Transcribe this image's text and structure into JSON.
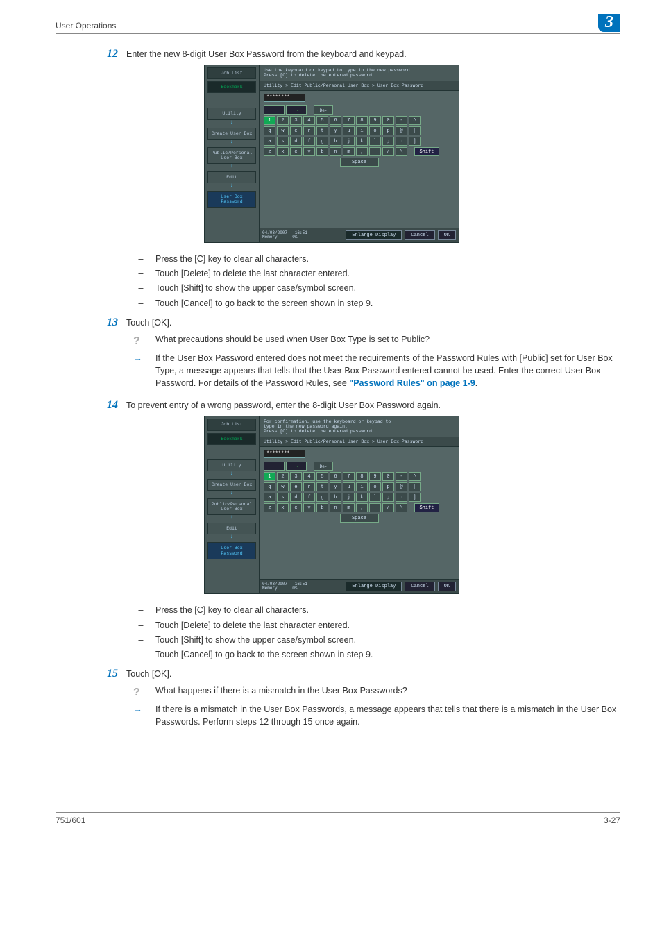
{
  "header": {
    "left": "User Operations",
    "right": "3"
  },
  "steps": {
    "s12": {
      "num": "12",
      "text": "Enter the new 8-digit User Box Password from the keyboard and keypad.",
      "bullets": [
        "Press the [C] key to clear all characters.",
        "Touch [Delete] to delete the last character entered.",
        "Touch [Shift] to show the upper case/symbol screen.",
        "Touch [Cancel] to go back to the screen shown in step 9."
      ]
    },
    "s13": {
      "num": "13",
      "text": "Touch [OK].",
      "q": "What precautions should be used when User Box Type is set to Public?",
      "a_pre": "If the User Box Password entered does not meet the requirements of the Password Rules with [Public] set for User Box Type, a message appears that tells that the User Box Password entered cannot be used. Enter the correct User Box Password. For details of the Password Rules, see ",
      "a_link": "\"Password Rules\" on page 1-9",
      "a_post": "."
    },
    "s14": {
      "num": "14",
      "text": "To prevent entry of a wrong password, enter the 8-digit User Box Password again.",
      "bullets": [
        "Press the [C] key to clear all characters.",
        "Touch [Delete] to delete the last character entered.",
        "Touch [Shift] to show the upper case/symbol screen.",
        "Touch [Cancel] to go back to the screen shown in step 9."
      ]
    },
    "s15": {
      "num": "15",
      "text": "Touch [OK].",
      "q": "What happens if there is a mismatch in the User Box Passwords?",
      "a": "If there is a mismatch in the User Box Passwords, a message appears that tells that there is a mismatch in the User Box Passwords. Perform steps 12 through 15 once again."
    }
  },
  "ui": {
    "msg1": "Use the keyboard or keypad to type in the new password.\nPress [C] to delete the entered password.",
    "msg2": "For confirmation, use the keyboard or keypad to\ntype in the new password again.\nPress [C] to delete the entered password.",
    "path": "Utility > Edit Public/Personal User Box > User Box Password",
    "input": "********",
    "left": {
      "job": "Job List",
      "bookmark": "Bookmark",
      "utility": "Utility",
      "create": "Create User Box",
      "pp": "Public/Personal\nUser Box",
      "edit": "Edit",
      "ubp": "User Box\nPassword"
    },
    "keys": {
      "del": "De-\nlete",
      "row1": [
        "1",
        "2",
        "3",
        "4",
        "5",
        "6",
        "7",
        "8",
        "9",
        "0",
        "-",
        "^"
      ],
      "row2": [
        "q",
        "w",
        "e",
        "r",
        "t",
        "y",
        "u",
        "i",
        "o",
        "p",
        "@",
        "["
      ],
      "row3": [
        "a",
        "s",
        "d",
        "f",
        "g",
        "h",
        "j",
        "k",
        "l",
        ";",
        ":",
        "]"
      ],
      "row4": [
        "z",
        "x",
        "c",
        "v",
        "b",
        "n",
        "m",
        ",",
        ".",
        "/",
        "\\"
      ],
      "shift": "Shift",
      "space": "Space"
    },
    "bottom": {
      "date": "04/03/2007",
      "time": "16:51",
      "mem": "Memory",
      "mempct": "0%",
      "enlarge": "Enlarge\nDisplay",
      "cancel": "Cancel",
      "ok": "OK"
    }
  },
  "footer": {
    "left": "751/601",
    "right": "3-27"
  }
}
